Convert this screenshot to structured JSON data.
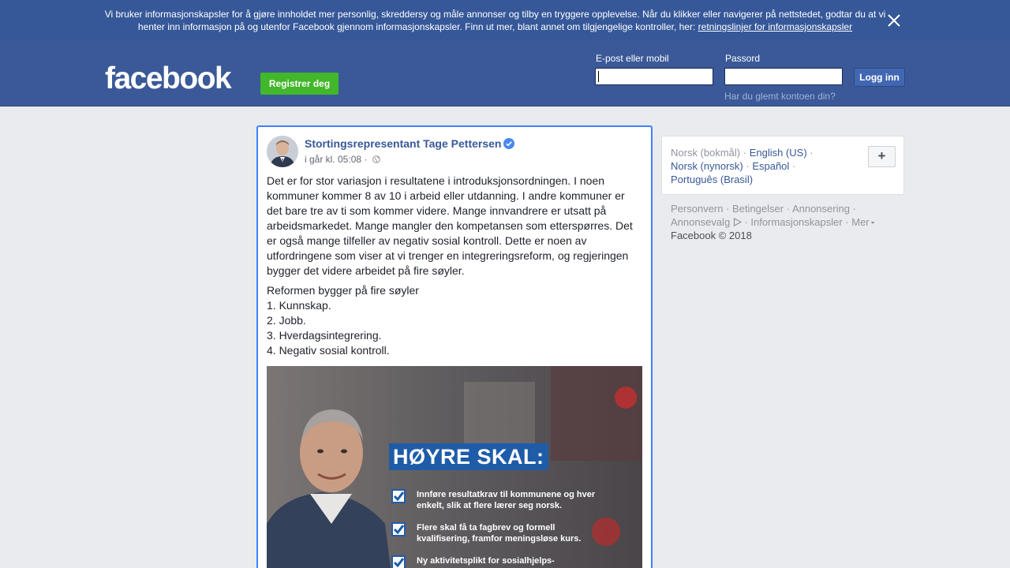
{
  "cookie_banner": {
    "text": "Vi bruker informasjonskapsler for å gjøre innholdet mer personlig, skreddersy og måle annonser og tilby en tryggere opplevelse. Når du klikker eller navigerer på nettstedet, godtar du at vi henter inn informasjon på og utenfor Facebook gjennom informasjonskapsler. Finn ut mer, blant annet om tilgjengelige kontroller, her:",
    "link": "retningslinjer for informasjonskapsler"
  },
  "header": {
    "logo": "facebook",
    "register_button": "Registrer deg",
    "email_label": "E-post eller mobil",
    "email_value": "",
    "password_label": "Passord",
    "password_value": "",
    "login_button": "Logg inn",
    "forgot_link": "Har du glemt kontoen din?"
  },
  "post": {
    "author": "Stortingsrepresentant Tage Pettersen",
    "time": "i går kl. 05:08 ·",
    "paragraph": "Det er for stor variasjon i resultatene i introduksjonsordningen. I noen kommuner kommer 8 av 10 i arbeid eller utdanning. I andre kommuner er det bare tre av ti som kommer videre. Mange innvandrere er utsatt på arbeidsmarkedet. Mange mangler den kompetansen som etterspørres. Det er også mange tilfeller av negativ sosial kontroll. Dette er noen av utfordringene som viser at vi trenger en integreringsreform, og regjeringen bygger det videre arbeidet på fire søyler.",
    "list_title": "Reformen bygger på fire søyler",
    "list_items": [
      "1. Kunnskap.",
      "2. Jobb.",
      "3. Hverdagsintegrering.",
      "4. Negativ sosial kontroll."
    ],
    "image": {
      "headline": "HØYRE SKAL:",
      "bullets": [
        "Innføre resultatkrav til kommunene og hver enkelt, slik at flere lærer seg norsk.",
        "Flere skal få ta fagbrev og formell kvalifisering, framfor meningsløse kurs.",
        "Ny aktivitetsplikt for sosialhjelps-"
      ]
    }
  },
  "languages": {
    "current": "Norsk (bokmål)",
    "others": [
      "English (US)",
      "Norsk (nynorsk)",
      "Español",
      "Português (Brasil)"
    ],
    "add_button": "+"
  },
  "footer": {
    "links": [
      "Personvern",
      "Betingelser",
      "Annonsering",
      "Annonsevalg",
      "Informasjonskapsler",
      "Mer"
    ],
    "copyright": "Facebook © 2018"
  },
  "colors": {
    "brand_blue": "#3b5998",
    "banner_blue": "#365899",
    "register_green": "#42b72a",
    "link_blue": "#385898",
    "image_headline_bg": "#1f5ca8"
  }
}
